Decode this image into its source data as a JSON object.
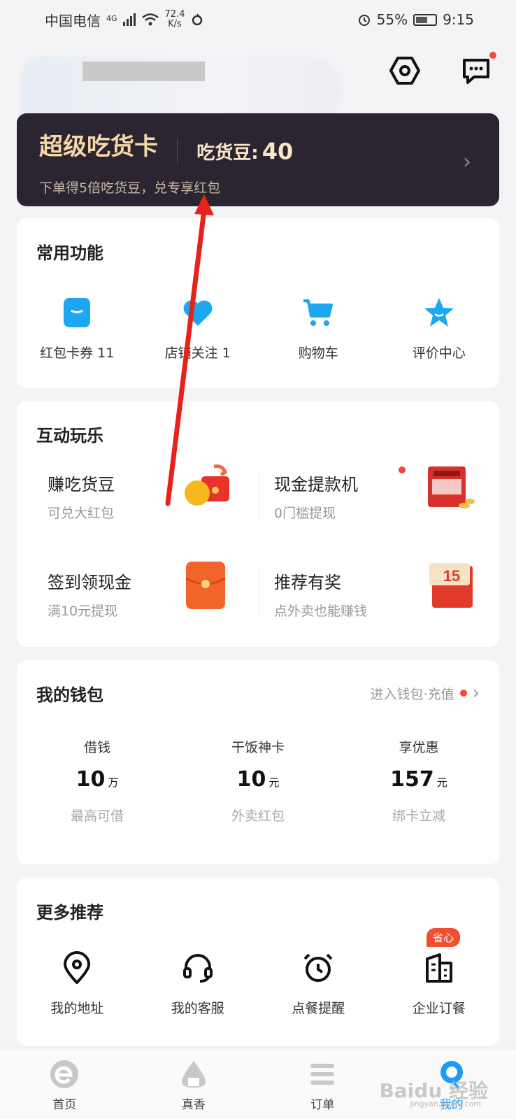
{
  "status": {
    "carrier": "中国电信",
    "network": "4G",
    "speed_value": "72.4",
    "speed_unit": "K/s",
    "battery": "55%",
    "time": "9:15"
  },
  "vip": {
    "title": "超级吃货卡",
    "beans_label": "吃货豆:",
    "beans_value": "40",
    "subtitle": "下单得5倍吃货豆，兑专享红包"
  },
  "common": {
    "title": "常用功能",
    "items": [
      {
        "label": "红包卡券 11",
        "icon": "coupon-icon"
      },
      {
        "label": "店铺关注 1",
        "icon": "heart-icon"
      },
      {
        "label": "购物车",
        "icon": "cart-icon"
      },
      {
        "label": "评价中心",
        "icon": "star-icon"
      }
    ]
  },
  "play": {
    "title": "互动玩乐",
    "items": [
      {
        "title": "赚吃货豆",
        "sub": "可兑大红包",
        "icon": "bean-redpacket-icon"
      },
      {
        "title": "现金提款机",
        "sub": "0门槛提现",
        "icon": "atm-icon"
      },
      {
        "title": "签到领现金",
        "sub": "满10元提现",
        "icon": "red-envelope-icon"
      },
      {
        "title": "推荐有奖",
        "sub": "点外卖也能赚钱",
        "icon": "reward-15-icon",
        "badge": "15"
      }
    ]
  },
  "wallet": {
    "title": "我的钱包",
    "link": "进入钱包·充值",
    "cols": [
      {
        "head": "借钱",
        "value": "10",
        "unit": "万",
        "foot": "最高可借"
      },
      {
        "head": "干饭神卡",
        "value": "10",
        "unit": "元",
        "foot": "外卖红包"
      },
      {
        "head": "享优惠",
        "value": "157",
        "unit": "元",
        "foot": "绑卡立减"
      }
    ]
  },
  "more": {
    "title": "更多推荐",
    "badge": "省心",
    "items": [
      {
        "label": "我的地址",
        "icon": "location-icon"
      },
      {
        "label": "我的客服",
        "icon": "headset-icon"
      },
      {
        "label": "点餐提醒",
        "icon": "alarm-icon"
      },
      {
        "label": "企业订餐",
        "icon": "building-icon"
      }
    ]
  },
  "tabs": [
    {
      "label": "首页",
      "icon": "home-e-icon"
    },
    {
      "label": "真香",
      "icon": "rice-ball-icon"
    },
    {
      "label": "订单",
      "icon": "orders-icon"
    },
    {
      "label": "我的",
      "icon": "profile-icon",
      "active": true
    }
  ],
  "watermark": {
    "main": "Baidu 经验",
    "sub": "jingyan.baidu.com"
  },
  "colors": {
    "accent": "#1a9cff",
    "red": "#f04a3b",
    "vip_bg": "#2a2530",
    "vip_gold": "#f6d7a8"
  }
}
